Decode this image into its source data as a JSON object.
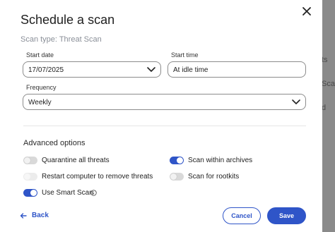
{
  "background": {
    "fragments": [
      "ts",
      "Sca",
      "d"
    ]
  },
  "dialog": {
    "title": "Schedule a scan",
    "subtitle": "Scan type: Threat Scan",
    "start_date": {
      "label": "Start date",
      "value": "17/07/2025"
    },
    "start_time": {
      "label": "Start time",
      "value": "At idle time"
    },
    "frequency": {
      "label": "Frequency",
      "value": "Weekly"
    },
    "advanced": {
      "heading": "Advanced options",
      "options": [
        {
          "label": "Quarantine all threats",
          "state": "off"
        },
        {
          "label": "Scan within archives",
          "state": "on"
        },
        {
          "label": "Restart computer to remove threats",
          "state": "disabled"
        },
        {
          "label": "Scan for rootkits",
          "state": "off"
        },
        {
          "label": "Use Smart Scan",
          "state": "on"
        }
      ]
    },
    "back_label": "Back",
    "cancel_label": "Cancel",
    "save_label": "Save"
  },
  "colors": {
    "accent": "#2f55c8",
    "overlay": "#7d7d7d"
  },
  "icons": [
    "close-icon",
    "chevron-down-icon",
    "info-icon",
    "arrow-left-icon"
  ]
}
